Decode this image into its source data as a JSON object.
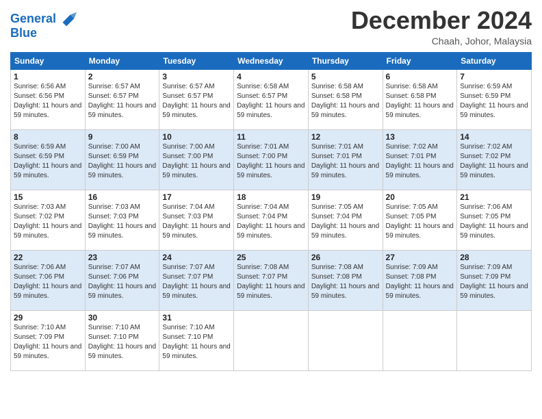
{
  "header": {
    "logo_line1": "General",
    "logo_line2": "Blue",
    "month": "December 2024",
    "location": "Chaah, Johor, Malaysia"
  },
  "weekdays": [
    "Sunday",
    "Monday",
    "Tuesday",
    "Wednesday",
    "Thursday",
    "Friday",
    "Saturday"
  ],
  "weeks": [
    [
      {
        "day": "1",
        "sunrise": "6:56 AM",
        "sunset": "6:56 PM",
        "daylight": "11 hours and 59 minutes."
      },
      {
        "day": "2",
        "sunrise": "6:57 AM",
        "sunset": "6:57 PM",
        "daylight": "11 hours and 59 minutes."
      },
      {
        "day": "3",
        "sunrise": "6:57 AM",
        "sunset": "6:57 PM",
        "daylight": "11 hours and 59 minutes."
      },
      {
        "day": "4",
        "sunrise": "6:58 AM",
        "sunset": "6:57 PM",
        "daylight": "11 hours and 59 minutes."
      },
      {
        "day": "5",
        "sunrise": "6:58 AM",
        "sunset": "6:58 PM",
        "daylight": "11 hours and 59 minutes."
      },
      {
        "day": "6",
        "sunrise": "6:58 AM",
        "sunset": "6:58 PM",
        "daylight": "11 hours and 59 minutes."
      },
      {
        "day": "7",
        "sunrise": "6:59 AM",
        "sunset": "6:59 PM",
        "daylight": "11 hours and 59 minutes."
      }
    ],
    [
      {
        "day": "8",
        "sunrise": "6:59 AM",
        "sunset": "6:59 PM",
        "daylight": "11 hours and 59 minutes."
      },
      {
        "day": "9",
        "sunrise": "7:00 AM",
        "sunset": "6:59 PM",
        "daylight": "11 hours and 59 minutes."
      },
      {
        "day": "10",
        "sunrise": "7:00 AM",
        "sunset": "7:00 PM",
        "daylight": "11 hours and 59 minutes."
      },
      {
        "day": "11",
        "sunrise": "7:01 AM",
        "sunset": "7:00 PM",
        "daylight": "11 hours and 59 minutes."
      },
      {
        "day": "12",
        "sunrise": "7:01 AM",
        "sunset": "7:01 PM",
        "daylight": "11 hours and 59 minutes."
      },
      {
        "day": "13",
        "sunrise": "7:02 AM",
        "sunset": "7:01 PM",
        "daylight": "11 hours and 59 minutes."
      },
      {
        "day": "14",
        "sunrise": "7:02 AM",
        "sunset": "7:02 PM",
        "daylight": "11 hours and 59 minutes."
      }
    ],
    [
      {
        "day": "15",
        "sunrise": "7:03 AM",
        "sunset": "7:02 PM",
        "daylight": "11 hours and 59 minutes."
      },
      {
        "day": "16",
        "sunrise": "7:03 AM",
        "sunset": "7:03 PM",
        "daylight": "11 hours and 59 minutes."
      },
      {
        "day": "17",
        "sunrise": "7:04 AM",
        "sunset": "7:03 PM",
        "daylight": "11 hours and 59 minutes."
      },
      {
        "day": "18",
        "sunrise": "7:04 AM",
        "sunset": "7:04 PM",
        "daylight": "11 hours and 59 minutes."
      },
      {
        "day": "19",
        "sunrise": "7:05 AM",
        "sunset": "7:04 PM",
        "daylight": "11 hours and 59 minutes."
      },
      {
        "day": "20",
        "sunrise": "7:05 AM",
        "sunset": "7:05 PM",
        "daylight": "11 hours and 59 minutes."
      },
      {
        "day": "21",
        "sunrise": "7:06 AM",
        "sunset": "7:05 PM",
        "daylight": "11 hours and 59 minutes."
      }
    ],
    [
      {
        "day": "22",
        "sunrise": "7:06 AM",
        "sunset": "7:06 PM",
        "daylight": "11 hours and 59 minutes."
      },
      {
        "day": "23",
        "sunrise": "7:07 AM",
        "sunset": "7:06 PM",
        "daylight": "11 hours and 59 minutes."
      },
      {
        "day": "24",
        "sunrise": "7:07 AM",
        "sunset": "7:07 PM",
        "daylight": "11 hours and 59 minutes."
      },
      {
        "day": "25",
        "sunrise": "7:08 AM",
        "sunset": "7:07 PM",
        "daylight": "11 hours and 59 minutes."
      },
      {
        "day": "26",
        "sunrise": "7:08 AM",
        "sunset": "7:08 PM",
        "daylight": "11 hours and 59 minutes."
      },
      {
        "day": "27",
        "sunrise": "7:09 AM",
        "sunset": "7:08 PM",
        "daylight": "11 hours and 59 minutes."
      },
      {
        "day": "28",
        "sunrise": "7:09 AM",
        "sunset": "7:09 PM",
        "daylight": "11 hours and 59 minutes."
      }
    ],
    [
      {
        "day": "29",
        "sunrise": "7:10 AM",
        "sunset": "7:09 PM",
        "daylight": "11 hours and 59 minutes."
      },
      {
        "day": "30",
        "sunrise": "7:10 AM",
        "sunset": "7:10 PM",
        "daylight": "11 hours and 59 minutes."
      },
      {
        "day": "31",
        "sunrise": "7:10 AM",
        "sunset": "7:10 PM",
        "daylight": "11 hours and 59 minutes."
      },
      null,
      null,
      null,
      null
    ]
  ]
}
